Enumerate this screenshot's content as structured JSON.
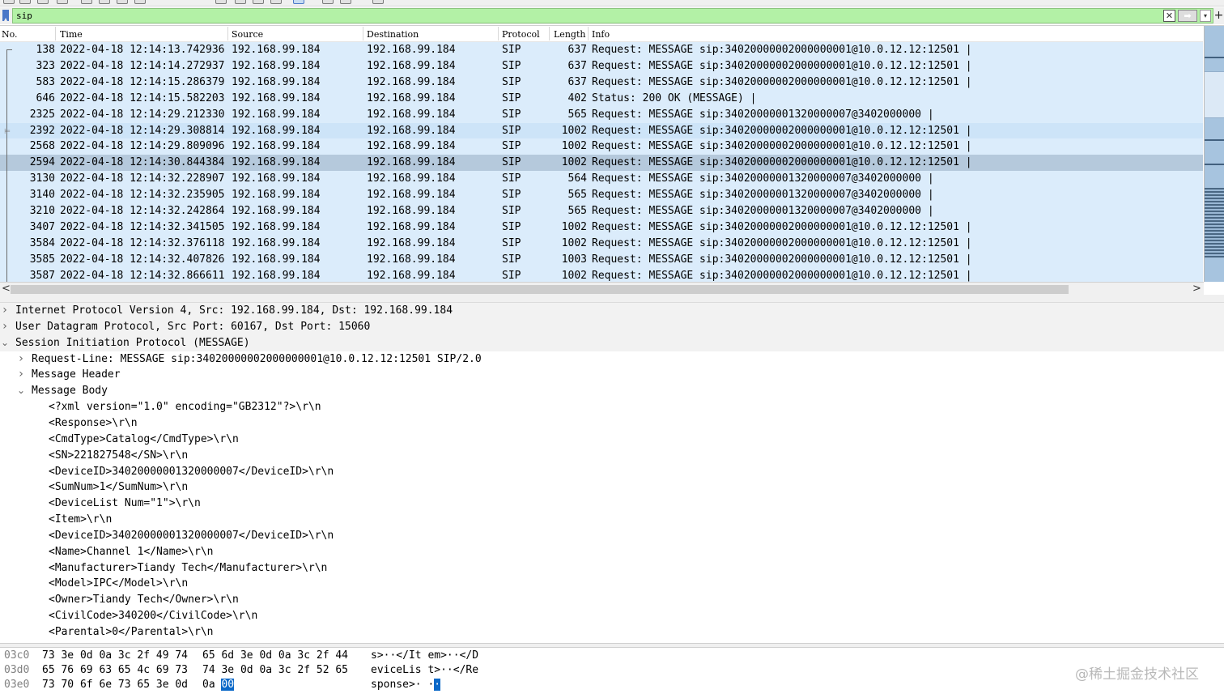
{
  "filter": {
    "value": "sip",
    "clear_glyph": "✕",
    "apply_glyph": "➡",
    "dropdown_glyph": "▾",
    "add_glyph": "+"
  },
  "packet_list": {
    "columns": [
      "No.",
      "Time",
      "Source",
      "Destination",
      "Protocol",
      "Length",
      "Info"
    ],
    "rows": [
      {
        "no": "138",
        "time": "2022-04-18 12:14:13.742936",
        "src": "192.168.99.184",
        "dst": "192.168.99.184",
        "proto": "SIP",
        "len": "637",
        "info": "Request: MESSAGE sip:34020000002000000001@10.0.12.12:12501 |"
      },
      {
        "no": "323",
        "time": "2022-04-18 12:14:14.272937",
        "src": "192.168.99.184",
        "dst": "192.168.99.184",
        "proto": "SIP",
        "len": "637",
        "info": "Request: MESSAGE sip:34020000002000000001@10.0.12.12:12501 |"
      },
      {
        "no": "583",
        "time": "2022-04-18 12:14:15.286379",
        "src": "192.168.99.184",
        "dst": "192.168.99.184",
        "proto": "SIP",
        "len": "637",
        "info": "Request: MESSAGE sip:34020000002000000001@10.0.12.12:12501 |"
      },
      {
        "no": "646",
        "time": "2022-04-18 12:14:15.582203",
        "src": "192.168.99.184",
        "dst": "192.168.99.184",
        "proto": "SIP",
        "len": "402",
        "info": "Status: 200 OK (MESSAGE)  |"
      },
      {
        "no": "2325",
        "time": "2022-04-18 12:14:29.212330",
        "src": "192.168.99.184",
        "dst": "192.168.99.184",
        "proto": "SIP",
        "len": "565",
        "info": "Request: MESSAGE sip:34020000001320000007@3402000000  |"
      },
      {
        "no": "2392",
        "time": "2022-04-18 12:14:29.308814",
        "src": "192.168.99.184",
        "dst": "192.168.99.184",
        "proto": "SIP",
        "len": "1002",
        "info": "Request: MESSAGE sip:34020000002000000001@10.0.12.12:12501 |"
      },
      {
        "no": "2568",
        "time": "2022-04-18 12:14:29.809096",
        "src": "192.168.99.184",
        "dst": "192.168.99.184",
        "proto": "SIP",
        "len": "1002",
        "info": "Request: MESSAGE sip:34020000002000000001@10.0.12.12:12501 |"
      },
      {
        "no": "2594",
        "time": "2022-04-18 12:14:30.844384",
        "src": "192.168.99.184",
        "dst": "192.168.99.184",
        "proto": "SIP",
        "len": "1002",
        "info": "Request: MESSAGE sip:34020000002000000001@10.0.12.12:12501 |"
      },
      {
        "no": "3130",
        "time": "2022-04-18 12:14:32.228907",
        "src": "192.168.99.184",
        "dst": "192.168.99.184",
        "proto": "SIP",
        "len": "564",
        "info": "Request: MESSAGE sip:34020000001320000007@3402000000  |"
      },
      {
        "no": "3140",
        "time": "2022-04-18 12:14:32.235905",
        "src": "192.168.99.184",
        "dst": "192.168.99.184",
        "proto": "SIP",
        "len": "565",
        "info": "Request: MESSAGE sip:34020000001320000007@3402000000  |"
      },
      {
        "no": "3210",
        "time": "2022-04-18 12:14:32.242864",
        "src": "192.168.99.184",
        "dst": "192.168.99.184",
        "proto": "SIP",
        "len": "565",
        "info": "Request: MESSAGE sip:34020000001320000007@3402000000  |"
      },
      {
        "no": "3407",
        "time": "2022-04-18 12:14:32.341505",
        "src": "192.168.99.184",
        "dst": "192.168.99.184",
        "proto": "SIP",
        "len": "1002",
        "info": "Request: MESSAGE sip:34020000002000000001@10.0.12.12:12501 |"
      },
      {
        "no": "3584",
        "time": "2022-04-18 12:14:32.376118",
        "src": "192.168.99.184",
        "dst": "192.168.99.184",
        "proto": "SIP",
        "len": "1002",
        "info": "Request: MESSAGE sip:34020000002000000001@10.0.12.12:12501 |"
      },
      {
        "no": "3585",
        "time": "2022-04-18 12:14:32.407826",
        "src": "192.168.99.184",
        "dst": "192.168.99.184",
        "proto": "SIP",
        "len": "1003",
        "info": "Request: MESSAGE sip:34020000002000000001@10.0.12.12:12501 |"
      },
      {
        "no": "3587",
        "time": "2022-04-18 12:14:32.866611",
        "src": "192.168.99.184",
        "dst": "192.168.99.184",
        "proto": "SIP",
        "len": "1002",
        "info": "Request: MESSAGE sip:34020000002000000001@10.0.12.12:12501 |"
      }
    ],
    "hover_row_no": "2392",
    "selected_row_no": "2594",
    "related_arrow_glyph": "⊨",
    "hscroll_left_glyph": "<",
    "hscroll_right_glyph": ">"
  },
  "details": {
    "lines": [
      {
        "level": 0,
        "arrow": ">",
        "text": "Internet Protocol Version 4, Src: 192.168.99.184, Dst: 192.168.99.184"
      },
      {
        "level": 0,
        "arrow": ">",
        "text": "User Datagram Protocol, Src Port: 60167, Dst Port: 15060"
      },
      {
        "level": 0,
        "arrow": "v",
        "text": "Session Initiation Protocol (MESSAGE)"
      },
      {
        "level": 1,
        "arrow": ">",
        "text": "Request-Line: MESSAGE sip:34020000002000000001@10.0.12.12:12501 SIP/2.0"
      },
      {
        "level": 1,
        "arrow": ">",
        "text": "Message Header"
      },
      {
        "level": 1,
        "arrow": "v",
        "text": "Message Body"
      },
      {
        "level": 2,
        "arrow": "",
        "text": "<?xml version=\"1.0\" encoding=\"GB2312\"?>\\r\\n"
      },
      {
        "level": 2,
        "arrow": "",
        "text": "<Response>\\r\\n"
      },
      {
        "level": 2,
        "arrow": "",
        "text": "<CmdType>Catalog</CmdType>\\r\\n"
      },
      {
        "level": 2,
        "arrow": "",
        "text": "<SN>221827548</SN>\\r\\n"
      },
      {
        "level": 2,
        "arrow": "",
        "text": "<DeviceID>34020000001320000007</DeviceID>\\r\\n"
      },
      {
        "level": 2,
        "arrow": "",
        "text": "<SumNum>1</SumNum>\\r\\n"
      },
      {
        "level": 2,
        "arrow": "",
        "text": "<DeviceList Num=\"1\">\\r\\n"
      },
      {
        "level": 2,
        "arrow": "",
        "text": "<Item>\\r\\n"
      },
      {
        "level": 2,
        "arrow": "",
        "text": "<DeviceID>34020000001320000007</DeviceID>\\r\\n"
      },
      {
        "level": 2,
        "arrow": "",
        "text": "<Name>Channel 1</Name>\\r\\n"
      },
      {
        "level": 2,
        "arrow": "",
        "text": "<Manufacturer>Tiandy Tech</Manufacturer>\\r\\n"
      },
      {
        "level": 2,
        "arrow": "",
        "text": "<Model>IPC</Model>\\r\\n"
      },
      {
        "level": 2,
        "arrow": "",
        "text": "<Owner>Tiandy Tech</Owner>\\r\\n"
      },
      {
        "level": 2,
        "arrow": "",
        "text": "<CivilCode>340200</CivilCode>\\r\\n"
      },
      {
        "level": 2,
        "arrow": "",
        "text": "<Parental>0</Parental>\\r\\n"
      }
    ]
  },
  "bytes": {
    "rows": [
      {
        "offset": "03c0",
        "hex1": "73 3e 0d 0a 3c 2f 49 74",
        "hex2": "65 6d 3e 0d 0a 3c 2f 44",
        "ascii": "s>··</It em>··</D",
        "sel_hex": "",
        "sel_ascii": ""
      },
      {
        "offset": "03d0",
        "hex1": "65 76 69 63 65 4c 69 73",
        "hex2": "74 3e 0d 0a 3c 2f 52 65",
        "ascii": "eviceLis t>··</Re",
        "sel_hex": "",
        "sel_ascii": ""
      },
      {
        "offset": "03e0",
        "hex1": "73 70 6f 6e 73 65 3e 0d",
        "hex2": "0a ",
        "ascii": "sponse>· ·",
        "sel_hex": "00",
        "sel_ascii": "·"
      }
    ]
  },
  "watermark": "@稀土掘金技术社区",
  "colors": {
    "filter_valid_bg": "#b3f1a6",
    "row_bg": "#dbecfb",
    "row_selected_bg": "#b5c9dc",
    "byte_selection": "#0a68c8"
  }
}
